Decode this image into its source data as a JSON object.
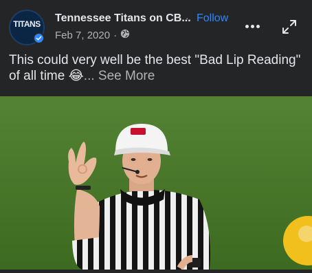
{
  "post": {
    "author": "Tennessee Titans on CB...",
    "separator": "·",
    "follow_label": "Follow",
    "date": "Feb 7, 2020",
    "date_separator": "·",
    "caption": "This could very well be the best \"Bad Lip Reading\" of all time",
    "caption_emoji": "😂",
    "see_more_label": "... See More"
  },
  "avatar": {
    "wordmark": "TITANS"
  },
  "icons": {
    "avatar": "titans-logo-icon",
    "verified": "verified-badge-icon",
    "privacy": "globe-icon",
    "more": "more-options-icon",
    "expand": "expand-icon"
  },
  "colors": {
    "background": "#242526",
    "link": "#2d88ff",
    "text_primary": "#e4e6eb",
    "text_secondary": "#b0b3b8"
  }
}
